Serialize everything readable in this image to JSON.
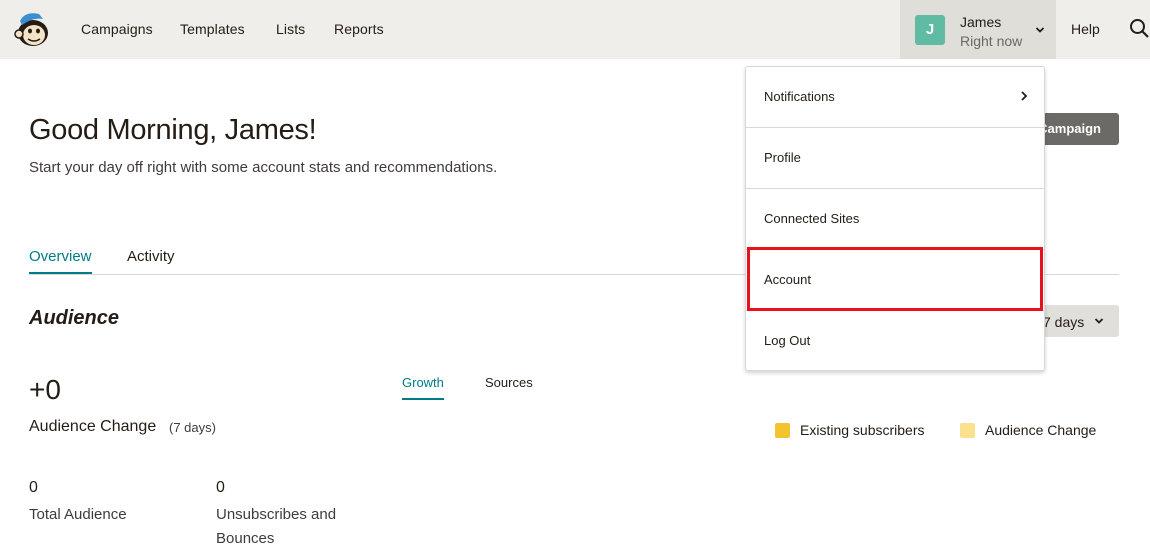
{
  "nav": {
    "links": [
      "Campaigns",
      "Templates",
      "Lists",
      "Reports"
    ],
    "help_label": "Help",
    "user": {
      "initial": "J",
      "name": "James",
      "status": "Right now",
      "avatar_color": "#5fbba4"
    }
  },
  "main": {
    "greeting": "Good Morning, James!",
    "subtitle": "Start your day off right with some account stats and recommendations.",
    "create_button_label": "Campaign",
    "tabs": [
      {
        "label": "Overview",
        "active": true
      },
      {
        "label": "Activity",
        "active": false
      }
    ],
    "audience": {
      "title": "Audience",
      "range_label": "7 days",
      "change_value": "+0",
      "change_label": "Audience Change",
      "change_period": "(7 days)",
      "subtabs": [
        {
          "label": "Growth",
          "active": true
        },
        {
          "label": "Sources",
          "active": false
        }
      ],
      "legend": [
        {
          "label": "Existing subscribers",
          "color": "#f4c430"
        },
        {
          "label": "Audience Change",
          "color": "#fbe08e"
        }
      ],
      "stats": [
        {
          "value": "0",
          "label": "Total Audience"
        },
        {
          "value": "0",
          "label": "Unsubscribes and Bounces"
        }
      ]
    }
  },
  "dropdown": {
    "items": [
      {
        "label": "Notifications",
        "has_submenu": true
      },
      {
        "label": "Profile",
        "has_submenu": false
      },
      {
        "label": "Connected Sites",
        "has_submenu": false
      },
      {
        "label": "Account",
        "has_submenu": false,
        "highlighted": true
      },
      {
        "label": "Log Out",
        "has_submenu": false
      }
    ]
  },
  "colors": {
    "accent": "#007c89",
    "highlight": "#e8131a",
    "nav_bg": "#efeeea"
  }
}
